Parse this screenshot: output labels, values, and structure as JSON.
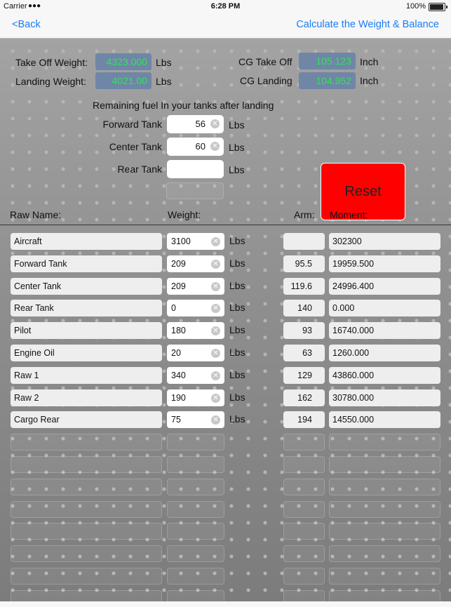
{
  "status_bar": {
    "carrier": "Carrier",
    "time": "6:28 PM",
    "battery": "100%",
    "battery_level": 1.0
  },
  "nav": {
    "back": "<Back",
    "action": "Calculate the Weight & Balance"
  },
  "summary": {
    "takeoff_weight_label": "Take Off Weight:",
    "takeoff_weight": "4323.000",
    "takeoff_unit": "Lbs",
    "landing_weight_label": "Landing Weight:",
    "landing_weight": "4021.00",
    "landing_unit": "Lbs",
    "cg_takeoff_label": "CG Take Off",
    "cg_takeoff": "105.123",
    "cg_takeoff_unit": "Inch",
    "cg_landing_label": "CG Landing",
    "cg_landing": "104.952",
    "cg_landing_unit": "Inch"
  },
  "fuel": {
    "heading": "Remaining fuel In your tanks after landing",
    "forward_label": "Forward Tank",
    "forward": "56",
    "forward_unit": "Lbs",
    "center_label": "Center Tank",
    "center": "60",
    "center_unit": "Lbs",
    "rear_label": "Rear Tank",
    "rear": "",
    "rear_unit": "Lbs"
  },
  "reset_label": "Reset",
  "table": {
    "headers": {
      "name": "Raw Name:",
      "weight": "Weight:",
      "arm": "Arm:",
      "moment": "Moment:"
    },
    "unit": "Lbs",
    "rows": [
      {
        "name": "Aircraft",
        "weight": "3100",
        "arm": "",
        "moment": "302300"
      },
      {
        "name": "Forward Tank",
        "weight": "209",
        "arm": "95.5",
        "moment": "19959.500"
      },
      {
        "name": "Center Tank",
        "weight": "209",
        "arm": "119.6",
        "moment": "24996.400"
      },
      {
        "name": "Rear Tank",
        "weight": "0",
        "arm": "140",
        "moment": "0.000"
      },
      {
        "name": "Pilot",
        "weight": "180",
        "arm": "93",
        "moment": "16740.000"
      },
      {
        "name": "Engine Oil",
        "weight": "20",
        "arm": "63",
        "moment": "1260.000"
      },
      {
        "name": "Raw 1",
        "weight": "340",
        "arm": "129",
        "moment": "43860.000"
      },
      {
        "name": "Raw 2",
        "weight": "190",
        "arm": "162",
        "moment": "30780.000"
      },
      {
        "name": "Cargo Rear",
        "weight": "75",
        "arm": "194",
        "moment": "14550.000"
      }
    ],
    "empty_rows": 8
  }
}
